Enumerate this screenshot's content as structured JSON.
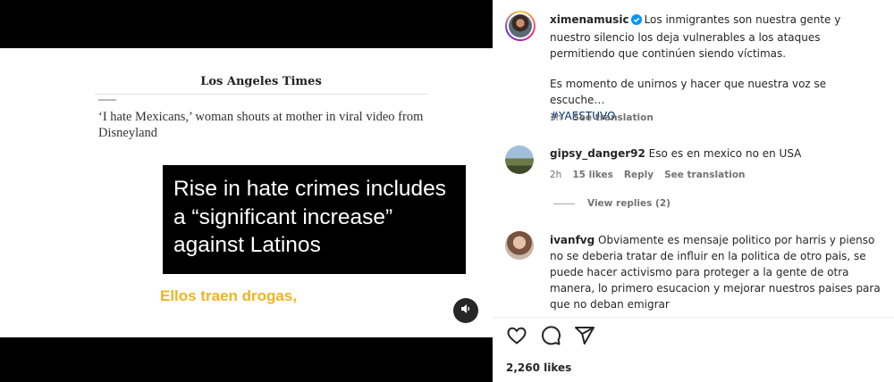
{
  "media": {
    "masthead": "Los Angeles Times",
    "headline": "‘I hate Mexicans,’ woman shouts at mother in viral video from Disneyland",
    "overlay_text": "Rise in hate crimes includes a “significant increase” against Latinos",
    "subtitle": "Ellos traen drogas,",
    "audio_icon": "speaker-icon"
  },
  "post": {
    "username": "ximenamusic",
    "verified": true,
    "caption_line1": "Los inmigrantes son nuestra gente y nuestro silencio los deja vulnerables a los ataques permitiendo que continúen siendo víctimas.",
    "caption_line2": "Es momento de unirnos y hacer que nuestra voz se escuche…",
    "hashtag": "#YAESTUVO",
    "time": "3h",
    "see_translation": "See translation"
  },
  "comments": [
    {
      "username": "gipsy_danger92",
      "text": "Eso es en mexico no en USA",
      "time": "2h",
      "likes": "15 likes",
      "reply": "Reply",
      "see_translation": "See translation",
      "view_replies": "View replies (2)"
    },
    {
      "username": "ivanfvg",
      "text": "Obviamente es mensaje politico por harris y pienso no se deberia tratar de influir en la politica de otro pais, se puede hacer activismo para proteger a la gente de otra manera, lo primero esucacion y mejorar nuestros paises para que no deban emigrar"
    }
  ],
  "actions": {
    "like_icon": "heart-icon",
    "comment_icon": "comment-icon",
    "share_icon": "send-icon"
  },
  "likes_count": "2,260 likes",
  "colors": {
    "subtitle": "#f0b323",
    "hashtag": "#00376b",
    "verified": "#0095f6",
    "muted": "#737373"
  }
}
